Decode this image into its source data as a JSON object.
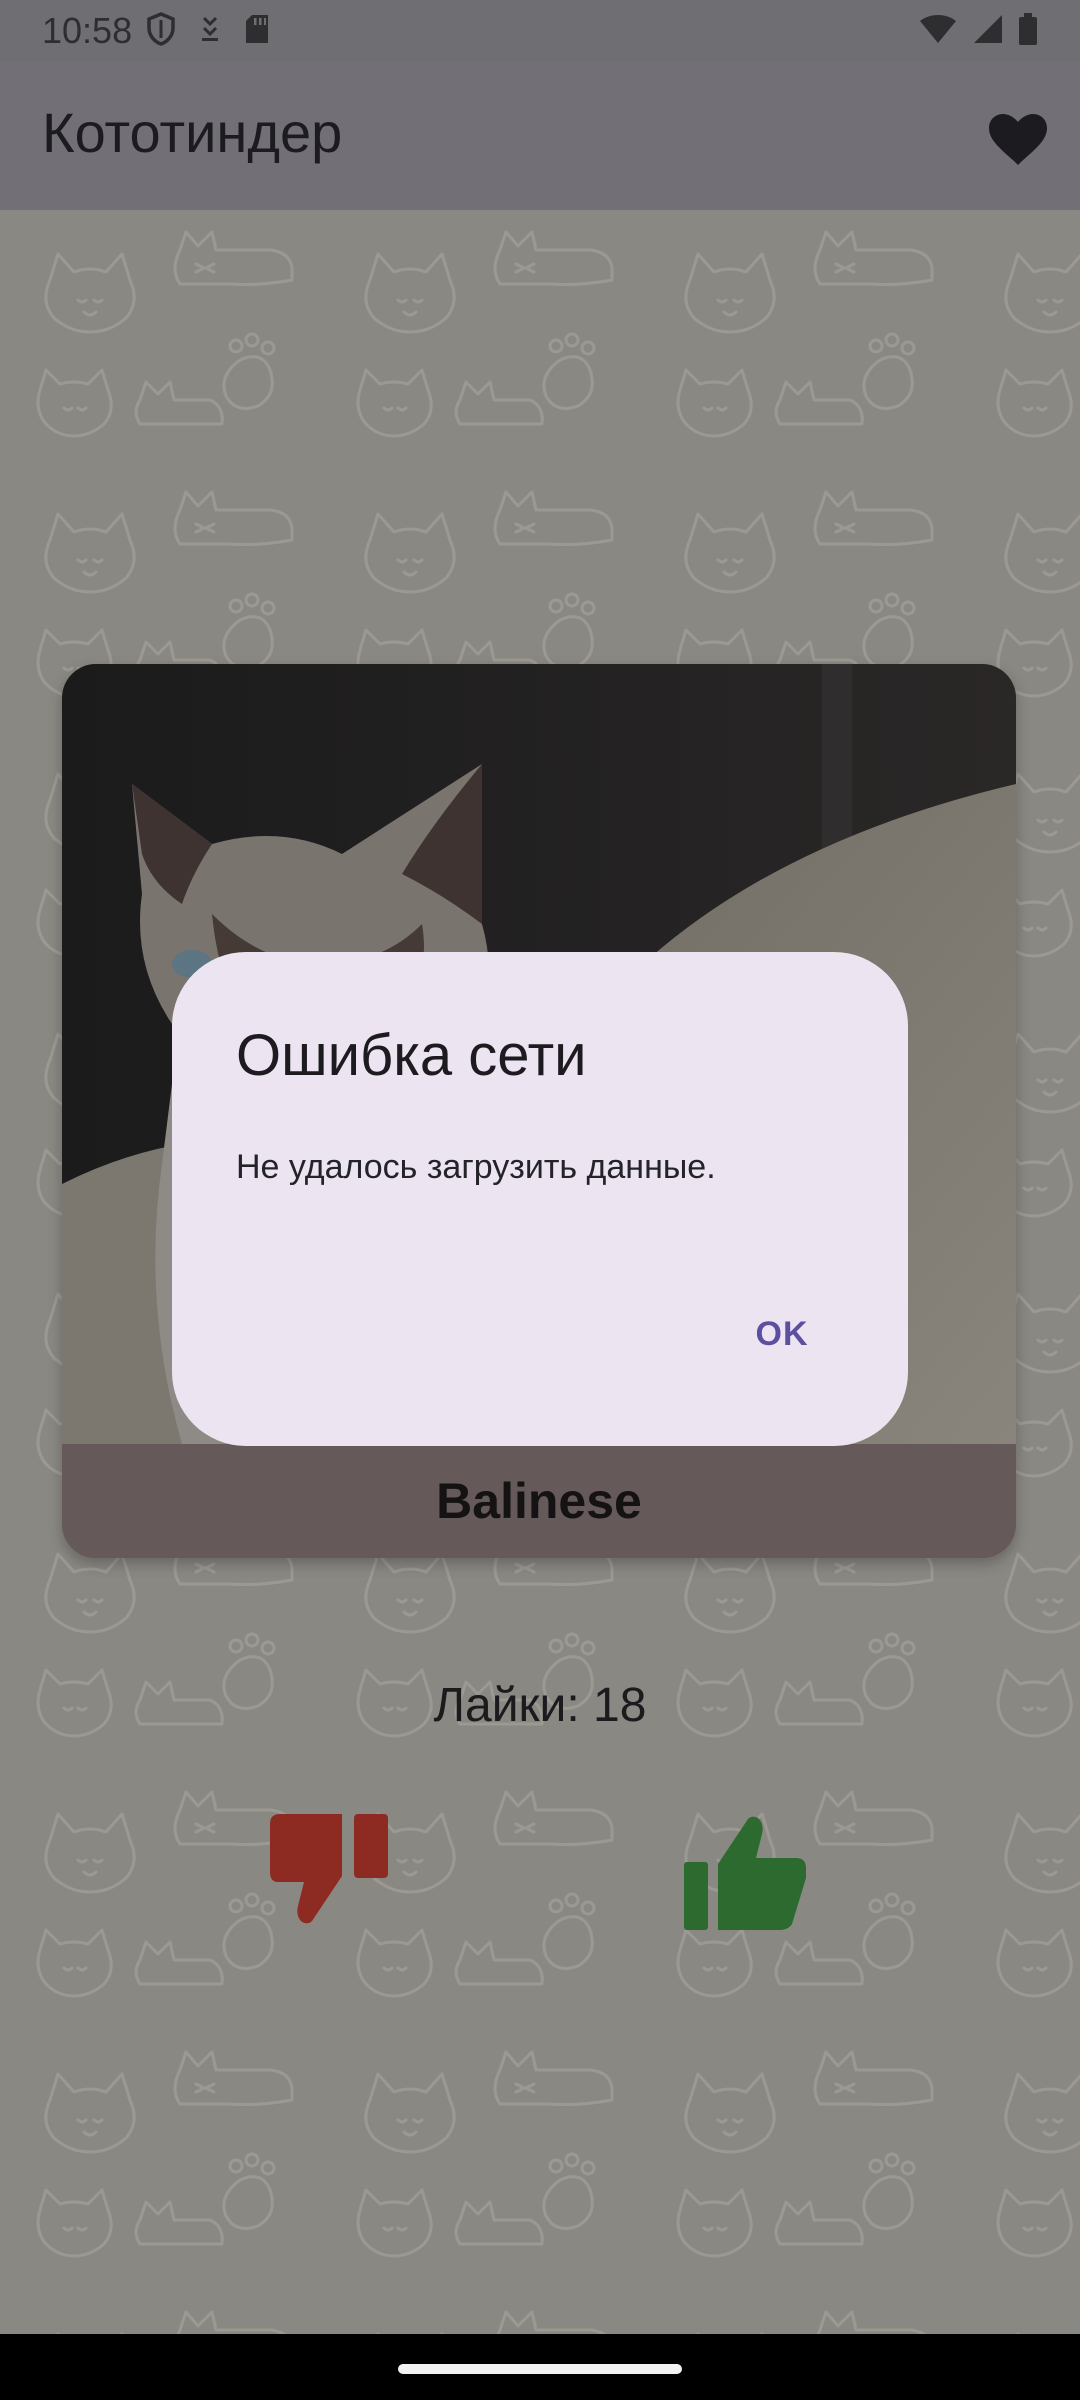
{
  "status_bar": {
    "time": "10:58",
    "left_icons": [
      "shield-icon",
      "download-icon",
      "sd-card-icon"
    ],
    "right_icons": [
      "wifi-icon",
      "signal-icon",
      "battery-icon"
    ]
  },
  "app_bar": {
    "title": "Кототиндер",
    "favorites_icon": "heart-icon"
  },
  "card": {
    "breed": "Balinese"
  },
  "likes_label": "Лайки: 18",
  "actions": {
    "dislike_icon": "thumb-down-icon",
    "like_icon": "thumb-up-icon",
    "dislike_color": "#8d2a22",
    "like_color": "#2d6a2f"
  },
  "dialog": {
    "title": "Ошибка сети",
    "message": "Не удалось загрузить данные.",
    "ok_label": "OK"
  }
}
